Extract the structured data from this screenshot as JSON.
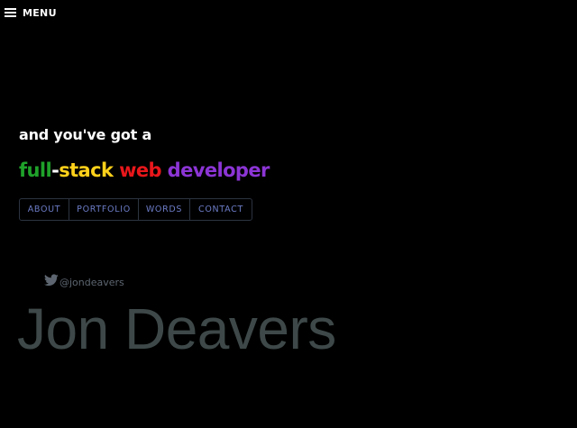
{
  "menu": {
    "label": "MENU",
    "icon": "hamburger-icon"
  },
  "intro": {
    "text": "and you've got a"
  },
  "headline": {
    "words": [
      {
        "text": "full",
        "color": "#1fa22a"
      },
      {
        "text": "-",
        "color": "#ffffff"
      },
      {
        "text": "stack",
        "color": "#ffd11a"
      },
      {
        "text": " ",
        "color": "#ffffff"
      },
      {
        "text": "web",
        "color": "#e8171b"
      },
      {
        "text": " ",
        "color": "#ffffff"
      },
      {
        "text": "developer",
        "color": "#8c35d6"
      }
    ]
  },
  "nav": {
    "items": [
      {
        "label": "ABOUT"
      },
      {
        "label": "PORTFOLIO"
      },
      {
        "label": "WORDS"
      },
      {
        "label": "CONTACT"
      }
    ]
  },
  "twitter": {
    "icon": "twitter-icon",
    "handle": "@jondeavers",
    "icon_color": "#5d6670"
  },
  "name": {
    "text": "Jon Deavers"
  }
}
